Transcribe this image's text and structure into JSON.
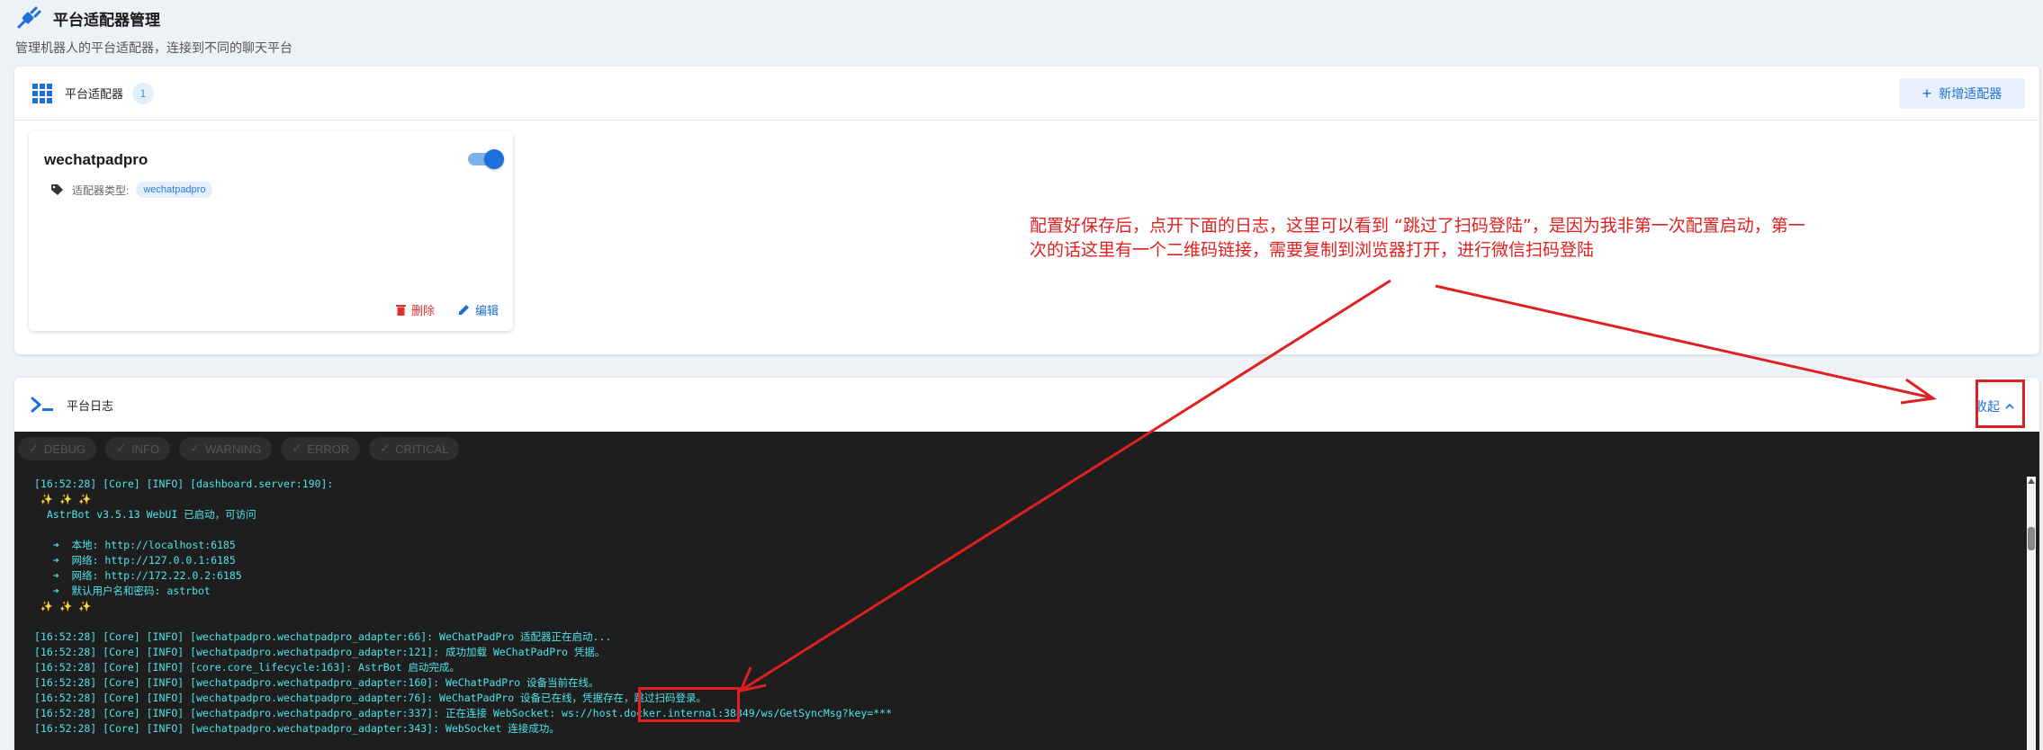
{
  "header": {
    "title": "平台适配器管理",
    "subtitle": "管理机器人的平台适配器，连接到不同的聊天平台"
  },
  "adapters_panel": {
    "title": "平台适配器",
    "count": "1",
    "add_button_label": "新增适配器",
    "card": {
      "name": "wechatpadpro",
      "enabled": true,
      "type_label": "适配器类型:",
      "type_value": "wechatpadpro",
      "delete_label": "删除",
      "edit_label": "编辑"
    }
  },
  "logs_panel": {
    "title": "平台日志",
    "collapse_label": "收起",
    "filters": [
      "DEBUG",
      "INFO",
      "WARNING",
      "ERROR",
      "CRITICAL"
    ],
    "lines": [
      "[16:52:28] [Core] [INFO] [dashboard.server:190]:",
      " ✨ ✨ ✨",
      "  AstrBot v3.5.13 WebUI 已启动，可访问",
      "",
      "   ➜  本地: http://localhost:6185",
      "   ➜  网络: http://127.0.0.1:6185",
      "   ➜  网络: http://172.22.0.2:6185",
      "   ➜  默认用户名和密码: astrbot",
      " ✨ ✨ ✨",
      "",
      "[16:52:28] [Core] [INFO] [wechatpadpro.wechatpadpro_adapter:66]: WeChatPadPro 适配器正在启动...",
      "[16:52:28] [Core] [INFO] [wechatpadpro.wechatpadpro_adapter:121]: 成功加载 WeChatPadPro 凭据。",
      "[16:52:28] [Core] [INFO] [core.core_lifecycle:163]: AstrBot 启动完成。",
      "[16:52:28] [Core] [INFO] [wechatpadpro.wechatpadpro_adapter:160]: WeChatPadPro 设备当前在线。",
      "[16:52:28] [Core] [INFO] [wechatpadpro.wechatpadpro_adapter:76]: WeChatPadPro 设备已在线，凭据存在，跳过扫码登录。",
      "[16:52:28] [Core] [INFO] [wechatpadpro.wechatpadpro_adapter:337]: 正在连接 WebSocket: ws://host.docker.internal:38849/ws/GetSyncMsg?key=***",
      "[16:52:28] [Core] [INFO] [wechatpadpro.wechatpadpro_adapter:343]: WebSocket 连接成功。"
    ]
  },
  "annotation": {
    "text": "配置好保存后，点开下面的日志，这里可以看到 “跳过了扫码登陆”，是因为我非第一次配置启动，第一次的话这里有一个二维码链接，需要复制到浏览器打开，进行微信扫码登陆",
    "color": "#e02020"
  },
  "colors": {
    "accent": "#1e6fd9",
    "danger": "#e03131",
    "log_text": "#4fe3ea",
    "log_background": "#1e1e1e"
  }
}
